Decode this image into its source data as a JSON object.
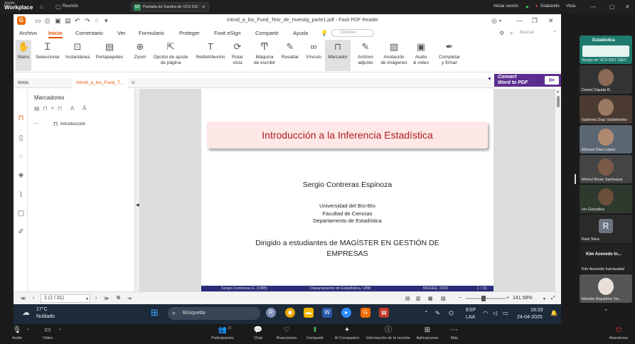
{
  "zoom_top": {
    "logo_top": "zoom",
    "logo_bottom": "Workplace",
    "meeting_label": "Reunión",
    "share_title": "Pantalla de Sandra de VCS DST C",
    "share_badge": "SD",
    "signin": "Iniciar sesión",
    "recording": "Grabando",
    "view": "Vista"
  },
  "foxit": {
    "title": "Introd_a_los_Fund_Teór_de_Investig_parte1.pdf - Foxit PDF Reader",
    "menu": [
      "Archivo",
      "Inicio",
      "Comentario",
      "Ver",
      "Formulario",
      "Proteger",
      "Foxit eSign",
      "Compartir",
      "Ayuda"
    ],
    "search_placeholder": "Docnne...",
    "bsearch": "Buscar",
    "tools": [
      {
        "l1": "Mano",
        "l2": ""
      },
      {
        "l1": "Seleccionar",
        "l2": ""
      },
      {
        "l1": "Instantánea",
        "l2": ""
      },
      {
        "l1": "Portapapeles",
        "l2": ""
      },
      {
        "l1": "Zoom",
        "l2": ""
      },
      {
        "l1": "Opción de ajuste",
        "l2": "de página"
      },
      {
        "l1": "Redistribución",
        "l2": ""
      },
      {
        "l1": "Rotar",
        "l2": "vista"
      },
      {
        "l1": "Máquina",
        "l2": "de escribir"
      },
      {
        "l1": "Resaltar",
        "l2": ""
      },
      {
        "l1": "Vínculo",
        "l2": ""
      },
      {
        "l1": "Marcador",
        "l2": ""
      },
      {
        "l1": "Archivo",
        "l2": "adjunto"
      },
      {
        "l1": "Anotación",
        "l2": "de imágenes"
      },
      {
        "l1": "Audio",
        "l2": "& vídeo"
      },
      {
        "l1": "Completar",
        "l2": "y firmar"
      }
    ],
    "convert_l1": "Convert",
    "convert_l2": "Word to PDF",
    "tabs": [
      "Inicio",
      "Introd_a_los_Fund_T..."
    ],
    "panel_title": "Marcadores",
    "bookmark": "Introducción",
    "page_nav": "1 (1 / 31)",
    "zoom_level": "141.58%"
  },
  "slide": {
    "title": "Introducción a la Inferencia Estadística",
    "author": "Sergio Contreras Espinoza",
    "inst1": "Universidad del Bío-Bío",
    "inst2": "Facultad de Ciencias",
    "inst3": "Departamento de Estadística",
    "aud1": "Dirigido a estudiantes de MAGÍSTER EN GESTIÓN DE",
    "aud2": "EMPRESAS",
    "foot_author": "Sergio Contreras E. (UBB)",
    "foot_dept": "Departamento de Estadística, UBB",
    "foot_prog": "MGSEE, 2022",
    "foot_page": "1 / 31"
  },
  "taskbar": {
    "temp": "17°C",
    "weather": "Nublado",
    "search": "Búsqueda",
    "lang1": "ESP",
    "lang2": "LAA",
    "time": "18:33",
    "date": "24-04-2025"
  },
  "participants": [
    {
      "name": "Sergio de VCS DST GEO"
    },
    {
      "name": "Daniel Zapata R."
    },
    {
      "name": "Gabriela Díaz Valdebenito"
    },
    {
      "name": "Manuel Díaz López"
    },
    {
      "name": "Michel Rivas Sanhueza"
    },
    {
      "name": "Ivo González"
    },
    {
      "name": "Raúl Silva"
    },
    {
      "name": "Kim Acevedo In..."
    },
    {
      "name": "Kim Acevedo Irarrázabal"
    },
    {
      "name": "Mariela Riquelme Vio..."
    }
  ],
  "gallery_brand": "Estadística",
  "avatar_letter": "R",
  "zoom_controls": {
    "audio": "Audio",
    "video": "Vídeo",
    "participants": "Participantes",
    "participants_count": "15",
    "chat": "Chat",
    "reactions": "Reacciones",
    "share": "Compartir",
    "companion": "AI Companion",
    "info": "Información de la reunión",
    "apps": "Aplicaciones",
    "more": "Más",
    "leave": "Abandonar"
  }
}
